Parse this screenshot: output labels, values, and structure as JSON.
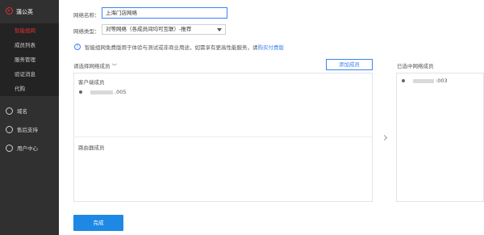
{
  "sidebar": {
    "brand": "蒲公英",
    "sub_items": [
      {
        "label": "智能组网",
        "active": true
      },
      {
        "label": "成员列表",
        "active": false
      },
      {
        "label": "服务管理",
        "active": false
      },
      {
        "label": "验证消息",
        "active": false
      },
      {
        "label": "代购",
        "active": false
      }
    ],
    "nav_items": [
      {
        "label": "域名",
        "icon": "domain-icon"
      },
      {
        "label": "售后支持",
        "icon": "support-icon"
      },
      {
        "label": "用户中心",
        "icon": "user-icon"
      }
    ]
  },
  "form": {
    "name_label": "网络名称：",
    "name_value": "上海门店网络",
    "type_label": "网络类型：",
    "type_value": "对等网络（各成员间均可互联）-推荐",
    "info_text": "智能组网免费版用于体验与测试或非商业用途，如需享有更高性能服务，请",
    "info_link": "购买付费版"
  },
  "members": {
    "select_label": "请选择网络成员",
    "add_button": "添加成员",
    "client_group": "客户端成员",
    "client_member_suffix": ".005",
    "router_group": "路由器成员",
    "selected_label": "已选中网络成员",
    "selected_member_suffix": ":003"
  },
  "footer": {
    "done_button": "完成"
  },
  "colors": {
    "accent": "#1e88e5",
    "brand_red": "#e03131",
    "sidebar_bg": "#303030"
  }
}
